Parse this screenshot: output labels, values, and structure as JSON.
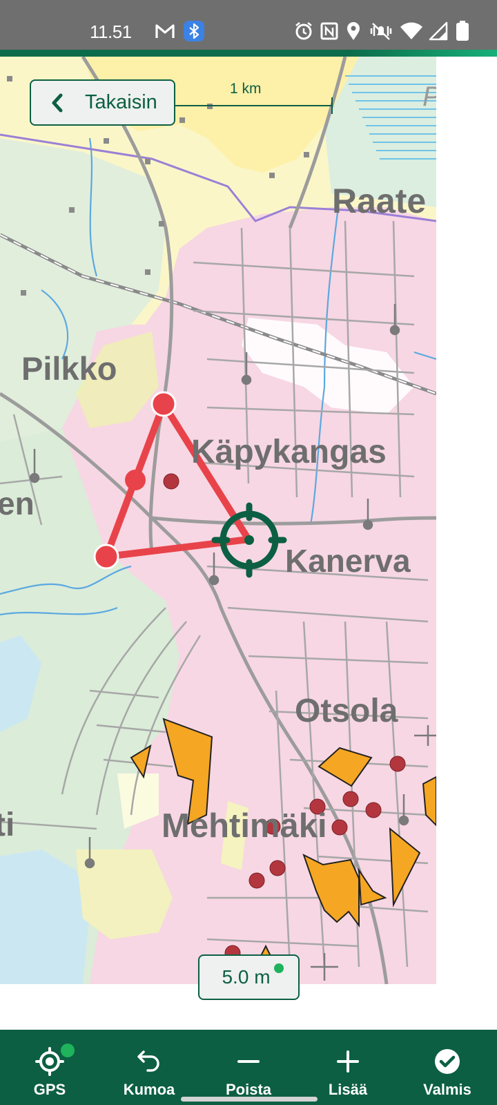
{
  "status_bar": {
    "time": "11.51",
    "icons": [
      "gmail-icon",
      "bluetooth-icon",
      "alarm-icon",
      "nfc-icon",
      "location-icon",
      "vibrate-icon",
      "wifi-icon",
      "signal-icon",
      "battery-icon"
    ]
  },
  "back_button": {
    "label": "Takaisin",
    "icon": "chevron-left-icon"
  },
  "scale_bar": {
    "label": "1 km"
  },
  "map": {
    "place_names": [
      "Raate",
      "Pilkko",
      "Käpykangas",
      "Kanerva",
      "Otsola",
      "Mehtimäki",
      "en",
      "ti",
      "P"
    ],
    "drawn_polygon": {
      "color": "#e8434a",
      "vertices": 3
    },
    "crosshair": {
      "icon": "crosshair-icon",
      "color": "#0c5f43"
    }
  },
  "accuracy": {
    "value": "5.0 m",
    "status_color": "#1fb35c"
  },
  "toolbar": {
    "items": [
      {
        "label": "GPS",
        "icon": "gps-icon"
      },
      {
        "label": "Kumoa",
        "icon": "undo-icon"
      },
      {
        "label": "Poista",
        "icon": "minus-icon"
      },
      {
        "label": "Lisää",
        "icon": "plus-icon"
      },
      {
        "label": "Valmis",
        "icon": "check-circle-icon"
      }
    ]
  },
  "colors": {
    "brand": "#0c5f43",
    "polygon": "#e8434a",
    "feature": "#f5a623"
  }
}
